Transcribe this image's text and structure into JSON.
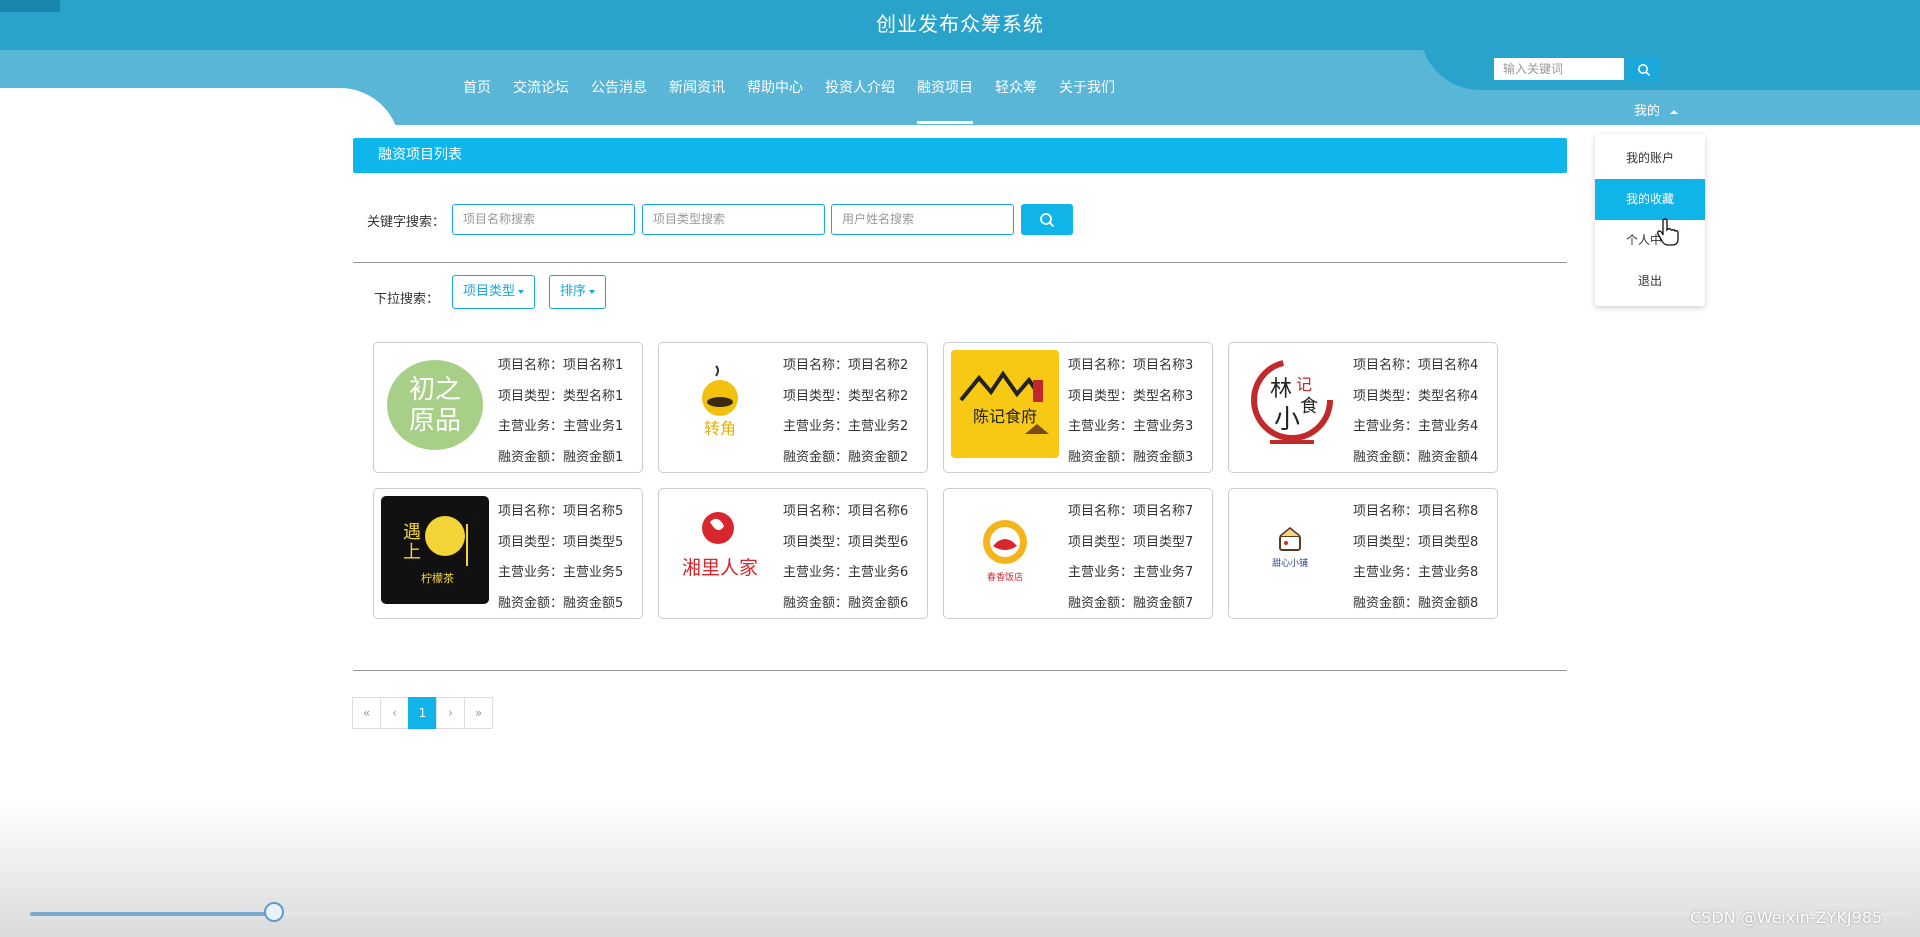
{
  "site": {
    "title": "创业发布众筹系统"
  },
  "nav": {
    "items": [
      {
        "label": "首页"
      },
      {
        "label": "交流论坛"
      },
      {
        "label": "公告消息"
      },
      {
        "label": "新闻资讯"
      },
      {
        "label": "帮助中心"
      },
      {
        "label": "投资人介绍"
      },
      {
        "label": "融资项目",
        "active": true
      },
      {
        "label": "轻众筹"
      },
      {
        "label": "关于我们"
      }
    ]
  },
  "header": {
    "search_placeholder": "输入关键词",
    "my_label": "我的"
  },
  "dropdown": {
    "items": [
      {
        "label": "我的账户"
      },
      {
        "label": "我的收藏",
        "active": true
      },
      {
        "label": "个人中心"
      },
      {
        "label": "退出"
      }
    ]
  },
  "page": {
    "section_title": "融资项目列表",
    "keyword_label": "关键字搜索：",
    "inputs": {
      "name_placeholder": "项目名称搜索",
      "type_placeholder": "项目类型搜索",
      "user_placeholder": "用户姓名搜索"
    },
    "dropdown_label": "下拉搜索：",
    "filter_type_label": "项目类型",
    "filter_sort_label": "排序"
  },
  "projects": [
    {
      "logo": "初之原品",
      "name": "项目名称：项目名称1",
      "type": "项目类型：类型名称1",
      "business": "主营业务：主营业务1",
      "amount": "融资金额：融资金额1"
    },
    {
      "logo": "转角",
      "name": "项目名称：项目名称2",
      "type": "项目类型：类型名称2",
      "business": "主营业务：主营业务2",
      "amount": "融资金额：融资金额2"
    },
    {
      "logo": "陈记食府",
      "name": "项目名称：项目名称3",
      "type": "项目类型：类型名称3",
      "business": "主营业务：主营业务3",
      "amount": "融资金额：融资金额3"
    },
    {
      "logo": "林记小食",
      "name": "项目名称：项目名称4",
      "type": "项目类型：类型名称4",
      "business": "主营业务：主营业务4",
      "amount": "融资金额：融资金额4"
    },
    {
      "logo": "遇上",
      "name": "项目名称：项目名称5",
      "type": "项目类型：项目类型5",
      "business": "主营业务：主营业务5",
      "amount": "融资金额：融资金额5"
    },
    {
      "logo": "湘里人家",
      "name": "项目名称：项目名称6",
      "type": "项目类型：项目类型6",
      "business": "主营业务：主营业务6",
      "amount": "融资金额：融资金额6"
    },
    {
      "logo": "春香",
      "name": "项目名称：项目名称7",
      "type": "项目类型：项目类型7",
      "business": "主营业务：主营业务7",
      "amount": "融资金额：融资金额7"
    },
    {
      "logo": "甜心小铺",
      "name": "项目名称：项目名称8",
      "type": "项目类型：项目类型8",
      "business": "主营业务：主营业务8",
      "amount": "融资金额：融资金额8"
    }
  ],
  "pagination": {
    "first": "«",
    "prev": "‹",
    "current": "1",
    "next": "›",
    "last": "»"
  },
  "video": {
    "progress_fraction": 0.13,
    "watermark": "CSDN @Weixin-ZYKJ985"
  },
  "colors": {
    "primary": "#10b4e8",
    "header": "#2aa3cc",
    "nav_band": "#5ab6d6"
  }
}
